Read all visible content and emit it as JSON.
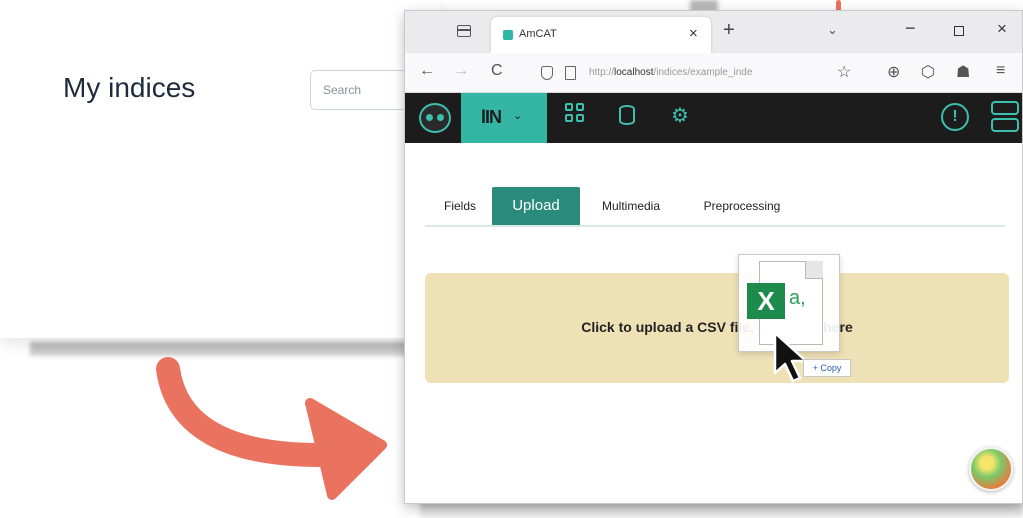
{
  "background_window": {
    "title": "My indices",
    "search_placeholder": "Search"
  },
  "browser": {
    "tab_title": "AmCAT",
    "tab_close": "×",
    "new_tab": "+",
    "tab_list": "⌄",
    "window_controls": {
      "minimize": "−",
      "maximize": "",
      "close": "×"
    },
    "nav": {
      "back": "←",
      "forward": "→",
      "reload": "C"
    },
    "url_prefix": "http://",
    "url_host": "localhost",
    "url_path": "/indices/example_inde",
    "toolbar": {
      "star": "☆",
      "account": "⊕",
      "extension": "⬡",
      "puzzle": "☗",
      "menu": "≡"
    }
  },
  "app": {
    "header": {
      "index_icon": "lIN",
      "index_chevron": "⌄",
      "settings_icon": "⚙",
      "info_icon": "!"
    },
    "tabs": [
      {
        "label": "Fields"
      },
      {
        "label": "Upload",
        "active": true
      },
      {
        "label": "Multimedia"
      },
      {
        "label": "Preprocessing"
      }
    ],
    "drop_zone_text": "Click to upload a CSV file, or drop it here",
    "drag_ghost": {
      "badge": "X",
      "letters": "a,",
      "copy_label": "+ Copy"
    }
  },
  "colors": {
    "accent": "#35b5a4",
    "active_tab": "#2a8b7c",
    "drop_zone": "#efe1b6",
    "arrow": "#e9735f",
    "header": "#1c1c1c"
  }
}
